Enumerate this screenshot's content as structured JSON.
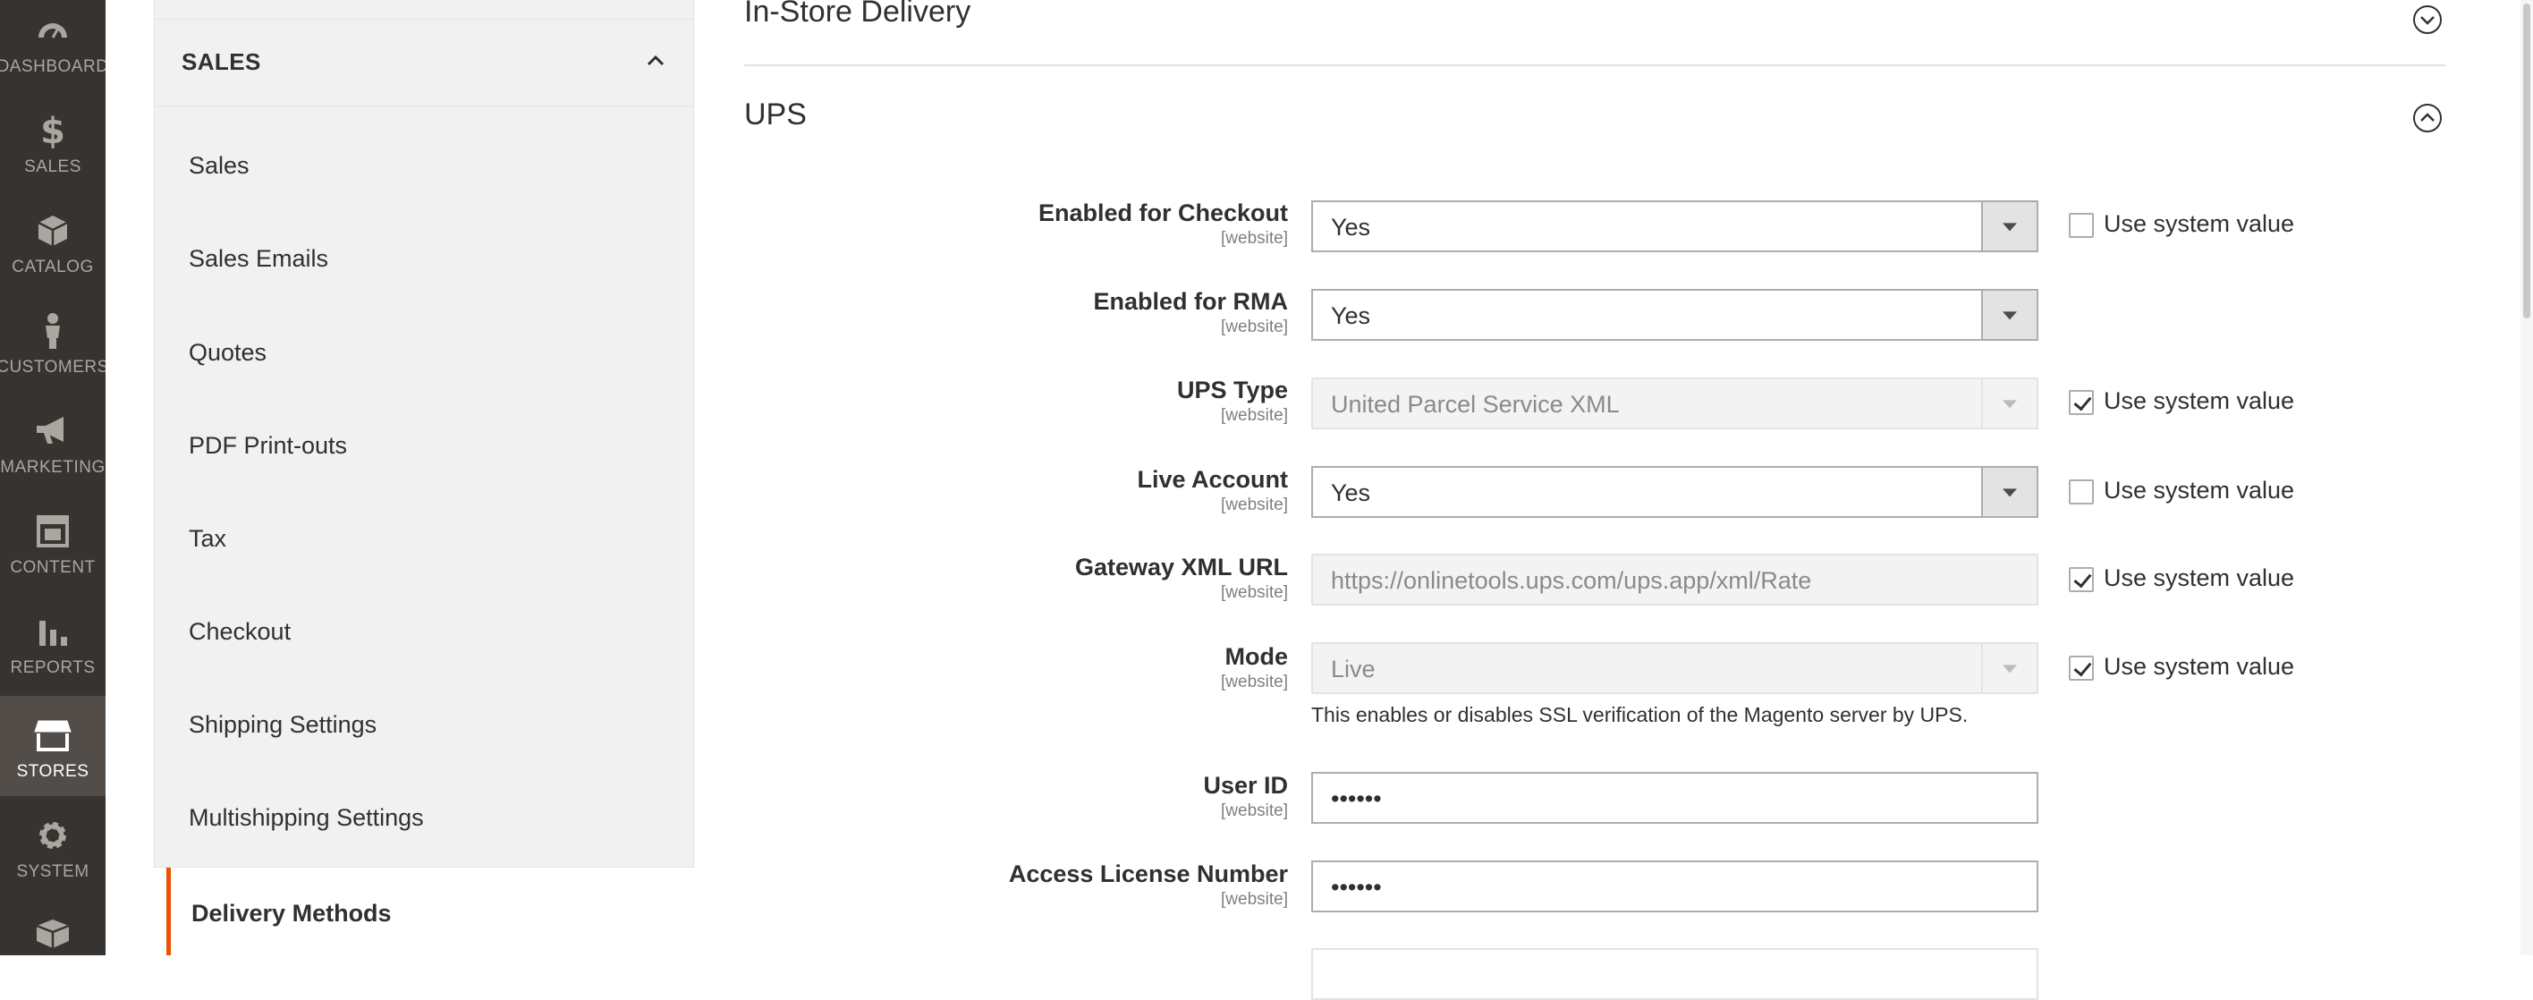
{
  "admin_nav": [
    {
      "label": "DASHBOARD",
      "icon": "dashboard-icon"
    },
    {
      "label": "SALES",
      "icon": "dollar-icon"
    },
    {
      "label": "CATALOG",
      "icon": "cube-icon"
    },
    {
      "label": "CUSTOMERS",
      "icon": "person-icon"
    },
    {
      "label": "MARKETING",
      "icon": "megaphone-icon"
    },
    {
      "label": "CONTENT",
      "icon": "layout-icon"
    },
    {
      "label": "REPORTS",
      "icon": "bar-chart-icon"
    },
    {
      "label": "STORES",
      "icon": "storefront-icon",
      "active": true
    },
    {
      "label": "SYSTEM",
      "icon": "gear-icon"
    },
    {
      "label": "",
      "icon": "boxes-icon"
    }
  ],
  "sidebar": {
    "group_title": "SALES",
    "items": [
      {
        "label": "Sales"
      },
      {
        "label": "Sales Emails"
      },
      {
        "label": "Quotes"
      },
      {
        "label": "PDF Print-outs"
      },
      {
        "label": "Tax"
      },
      {
        "label": "Checkout"
      },
      {
        "label": "Shipping Settings"
      },
      {
        "label": "Multishipping Settings"
      }
    ],
    "active_item": "Delivery Methods"
  },
  "sections": {
    "in_store": {
      "title": "In-Store Delivery"
    },
    "ups": {
      "title": "UPS"
    }
  },
  "ups_fields": {
    "enabled_checkout": {
      "label": "Enabled for Checkout",
      "scope": "[website]",
      "value": "Yes",
      "system_value_label": "Use system value",
      "use_system": false
    },
    "enabled_rma": {
      "label": "Enabled for RMA",
      "scope": "[website]",
      "value": "Yes"
    },
    "ups_type": {
      "label": "UPS Type",
      "scope": "[website]",
      "value": "United Parcel Service XML",
      "system_value_label": "Use system value",
      "use_system": true
    },
    "live_account": {
      "label": "Live Account",
      "scope": "[website]",
      "value": "Yes",
      "system_value_label": "Use system value",
      "use_system": false
    },
    "gateway_url": {
      "label": "Gateway XML URL",
      "scope": "[website]",
      "value": "https://onlinetools.ups.com/ups.app/xml/Rate",
      "system_value_label": "Use system value",
      "use_system": true
    },
    "mode": {
      "label": "Mode",
      "scope": "[website]",
      "value": "Live",
      "note": "This enables or disables SSL verification of the Magento server by UPS.",
      "system_value_label": "Use system value",
      "use_system": true
    },
    "user_id": {
      "label": "User ID",
      "scope": "[website]",
      "value": "••••••"
    },
    "access_license": {
      "label": "Access License Number",
      "scope": "[website]",
      "value": "••••••"
    }
  },
  "colors": {
    "nav_bg": "#373330",
    "nav_active_bg": "#524d49",
    "accent": "#eb5202",
    "sidebar_bg": "#f1f1f1"
  }
}
